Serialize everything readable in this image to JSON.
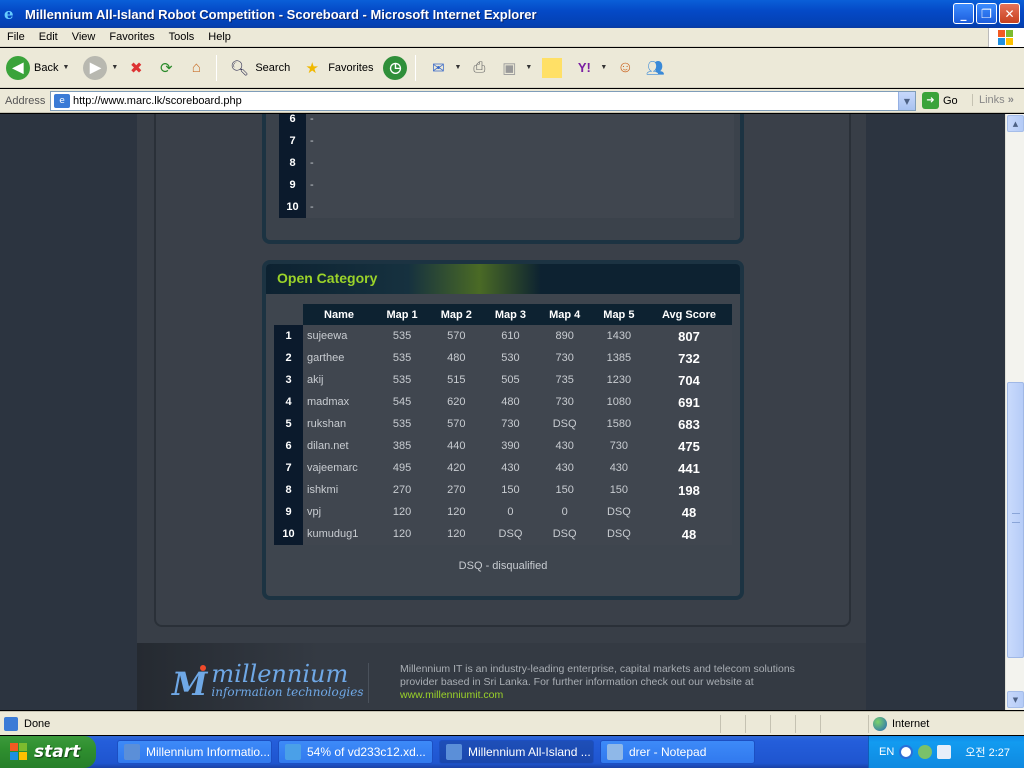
{
  "window": {
    "title": "Millennium All-Island Robot Competition - Scoreboard - Microsoft Internet Explorer",
    "minimize": "_",
    "maximize": "❐",
    "close": "✕"
  },
  "menu": [
    "File",
    "Edit",
    "View",
    "Favorites",
    "Tools",
    "Help"
  ],
  "toolbar": {
    "back": "Back",
    "search": "Search",
    "favorites": "Favorites"
  },
  "address": {
    "label": "Address",
    "url": "http://www.marc.lk/scoreboard.php",
    "go": "Go",
    "links": "Links"
  },
  "previous_list": [
    {
      "rank": "6",
      "name": "-"
    },
    {
      "rank": "7",
      "name": "-"
    },
    {
      "rank": "8",
      "name": "-"
    },
    {
      "rank": "9",
      "name": "-"
    },
    {
      "rank": "10",
      "name": "-"
    }
  ],
  "category": {
    "title": "Open Category",
    "headers": [
      "Name",
      "Map 1",
      "Map 2",
      "Map 3",
      "Map 4",
      "Map 5",
      "Avg Score"
    ],
    "rows": [
      {
        "rank": "1",
        "name": "sujeewa",
        "m1": "535",
        "m2": "570",
        "m3": "610",
        "m4": "890",
        "m5": "1430",
        "avg": "807"
      },
      {
        "rank": "2",
        "name": "garthee",
        "m1": "535",
        "m2": "480",
        "m3": "530",
        "m4": "730",
        "m5": "1385",
        "avg": "732"
      },
      {
        "rank": "3",
        "name": "akij",
        "m1": "535",
        "m2": "515",
        "m3": "505",
        "m4": "735",
        "m5": "1230",
        "avg": "704"
      },
      {
        "rank": "4",
        "name": "madmax",
        "m1": "545",
        "m2": "620",
        "m3": "480",
        "m4": "730",
        "m5": "1080",
        "avg": "691"
      },
      {
        "rank": "5",
        "name": "rukshan",
        "m1": "535",
        "m2": "570",
        "m3": "730",
        "m4": "DSQ",
        "m5": "1580",
        "avg": "683"
      },
      {
        "rank": "6",
        "name": "dilan.net",
        "m1": "385",
        "m2": "440",
        "m3": "390",
        "m4": "430",
        "m5": "730",
        "avg": "475"
      },
      {
        "rank": "7",
        "name": "vajeemarc",
        "m1": "495",
        "m2": "420",
        "m3": "430",
        "m4": "430",
        "m5": "430",
        "avg": "441"
      },
      {
        "rank": "8",
        "name": "ishkmi",
        "m1": "270",
        "m2": "270",
        "m3": "150",
        "m4": "150",
        "m5": "150",
        "avg": "198"
      },
      {
        "rank": "9",
        "name": "vpj",
        "m1": "120",
        "m2": "120",
        "m3": "0",
        "m4": "0",
        "m5": "DSQ",
        "avg": "48"
      },
      {
        "rank": "10",
        "name": "kumudug1",
        "m1": "120",
        "m2": "120",
        "m3": "DSQ",
        "m4": "DSQ",
        "m5": "DSQ",
        "avg": "48"
      }
    ],
    "note": "DSQ - disqualified"
  },
  "footer": {
    "logo_name": "millennium",
    "logo_sub": "information technologies",
    "text": "Millennium IT is an industry-leading enterprise, capital markets and telecom solutions provider based in Sri Lanka. For further information check out our website at",
    "link": "www.millenniumit.com"
  },
  "status": {
    "left": "Done",
    "zone": "Internet"
  },
  "taskbar": {
    "start": "start",
    "tasks": [
      {
        "label": "Millennium Informatio...",
        "color": "#5b8fd8",
        "active": false
      },
      {
        "label": "54% of vd233c12.xd...",
        "color": "#4aa0e8",
        "active": false
      },
      {
        "label": "Millennium All-Island ...",
        "color": "#5b8fd8",
        "active": true
      },
      {
        "label": "drer - Notepad",
        "color": "#8fb8e8",
        "active": false
      }
    ],
    "lang": "EN",
    "clock": "오전 2:27"
  },
  "colors": {
    "accent_green": "#9bd329",
    "header_navy": "#0d2231",
    "page_bg": "#383e47"
  }
}
